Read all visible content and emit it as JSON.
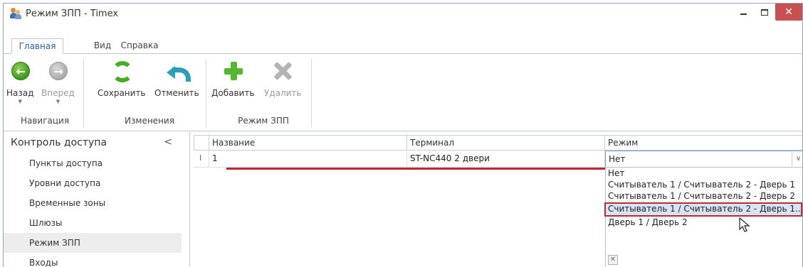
{
  "window": {
    "title": "Режим ЗПП - Timex"
  },
  "ribbon_tabs": [
    "Главная",
    "Вид",
    "Справка"
  ],
  "ribbon": {
    "back": "Назад",
    "forward": "Вперед",
    "save": "Сохранить",
    "cancel": "Отменить",
    "add": "Добавить",
    "delete": "Удалить",
    "groups": {
      "navigation": "Навигация",
      "changes": "Изменения",
      "mode": "Режим ЗПП"
    }
  },
  "sidebar": {
    "header": "Контроль доступа",
    "items": [
      "Пункты доступа",
      "Уровни доступа",
      "Временные зоны",
      "Шлюзы",
      "Режим ЗПП",
      "Входы"
    ]
  },
  "grid": {
    "columns": [
      "Название",
      "Терминал",
      "Режим"
    ],
    "row": {
      "indicator": "I",
      "name": "1",
      "terminal": "ST-NC440 2 двери",
      "mode": "Нет"
    }
  },
  "dropdown": {
    "options": [
      "Нет",
      "Считыватель 1 / Считыватель 2 - Дверь 1",
      "Считыватель 1 / Считыватель 2 - Дверь 2",
      "Считыватель 1 / Считыватель 2 - Дверь 1...",
      "Дверь 1 / Дверь 2"
    ],
    "highlighted_index": 3
  },
  "colors": {
    "accent": "#2f5f9e",
    "highlight_border": "#c0282e",
    "close_button": "#c75050"
  }
}
